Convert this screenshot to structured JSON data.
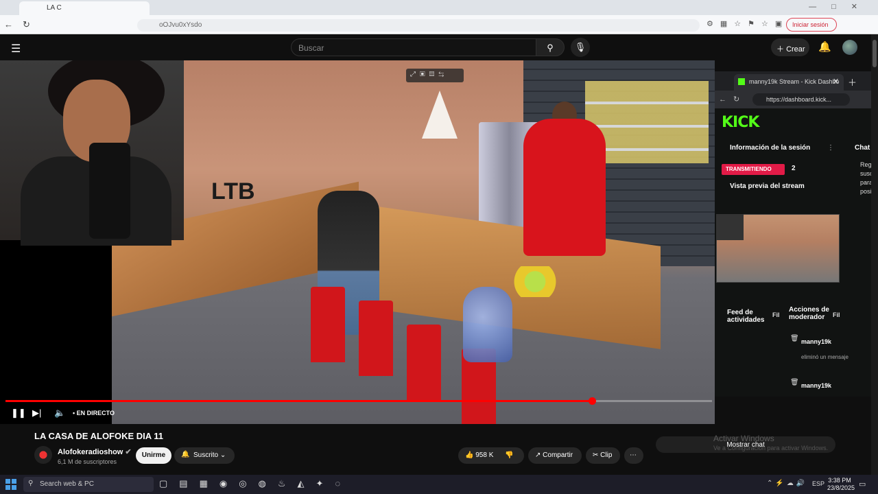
{
  "browser": {
    "tab_title": "LA C",
    "url_fragment": "oOJvu0xYsdo",
    "login_label": "Iniciar sesión"
  },
  "youtube": {
    "search_placeholder": "Buscar",
    "create_label": "Crear",
    "video": {
      "title": "LA CASA DE ALOFOKE DIA 11",
      "live_label": "EN DIRECTO",
      "overlay_text": "LTB",
      "progress": 0.83
    },
    "channel": {
      "name": "Alofokeradioshow",
      "subscribers": "6,1 M de suscriptores",
      "join_label": "Unirme",
      "subscribed_label": "Suscrito"
    },
    "actions": {
      "likes": "958 K",
      "share_label": "Compartir",
      "clip_label": "Clip"
    },
    "live_chat_button": "Mostrar chat"
  },
  "kick_window": {
    "tab_title": "manny19k Stream - Kick Dashbo",
    "url": "https://dashboard.kick...",
    "logo": "KICK",
    "session_info": "Información de la sesión",
    "chat_label": "Chat",
    "status": "TRANSMITIENDO",
    "viewers": "2",
    "preview_label": "Vista previa del stream",
    "activity_feed": "Feed de actividades",
    "mod_actions": "Acciones de moderador",
    "filter_short_a": "Fil",
    "filter_short_b": "Fil",
    "chat_side_text": "Regal suscr para t posici",
    "mod_entries": [
      {
        "user": "manny19k",
        "action": "eliminó un mensaje"
      },
      {
        "user": "manny19k",
        "action": ""
      }
    ],
    "accent_color": "#53fc18"
  },
  "windows": {
    "activate_title": "Activar Windows",
    "activate_sub": "Ve a Configuración para activar Windows.",
    "taskbar_search": "Search web & PC",
    "language": "ESP",
    "time": "3:38 PM",
    "date": "23/8/2025"
  }
}
